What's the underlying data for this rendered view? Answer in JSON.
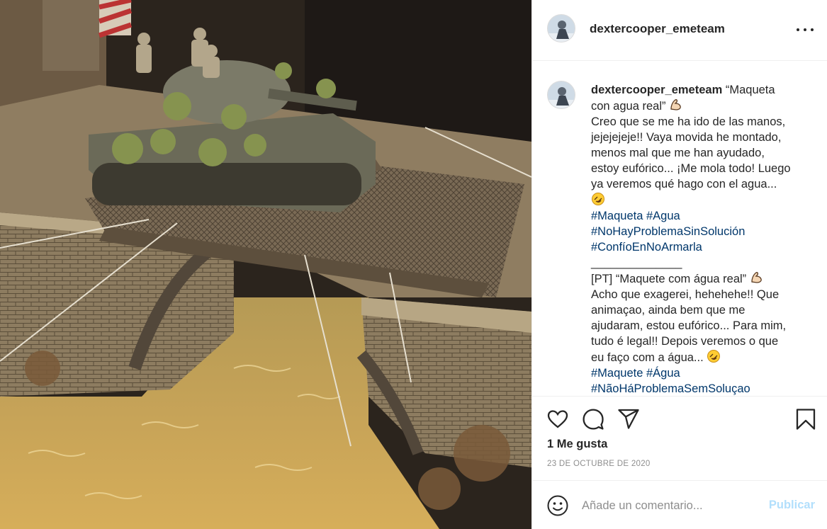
{
  "post": {
    "username": "dextercooper_emeteam",
    "caption_lines": [
      "“Maqueta",
      "con agua real”",
      "Creo que se me ha ido de las manos,",
      "jejejejeje!! Vaya movida he montado,",
      "menos mal que me han ayudado,",
      "estoy eufórico... ¡Me mola todo! Luego",
      "ya veremos qué hago con el agua...",
      "",
      "#Maqueta #Agua",
      "#NoHayProblemaSinSolución",
      "#ConfíoEnNoArmarla",
      "______________",
      "[PT] “Maquete com água real”",
      "Acho que exagerei, hehehehe!! Que",
      "animaçao, ainda bem que me",
      "ajudaram, estou eufórico... Para mim,",
      "tudo é legal!! Depois veremos o que",
      "eu faço com a água...",
      "#Maquete #Água",
      "#NãoHáProblemaSemSoluçao"
    ],
    "likes": "1 Me gusta",
    "date": "23 DE OCTUBRE DE 2020"
  },
  "icons": {
    "more": "more-options-icon",
    "like": "heart-icon",
    "comment": "comment-bubble-icon",
    "share": "paper-plane-icon",
    "save": "bookmark-icon",
    "emoji": "smiley-face-icon",
    "flexed_biceps": "flexed-biceps-emoji",
    "rofl": "rolling-laughing-emoji"
  },
  "comment": {
    "placeholder": "Añade un comentario...",
    "submit_label": "Publicar"
  },
  "colors": {
    "link": "#00376b",
    "publish_disabled": "#b2dffc",
    "muted": "#8e8e8e",
    "divider": "#efefef"
  }
}
